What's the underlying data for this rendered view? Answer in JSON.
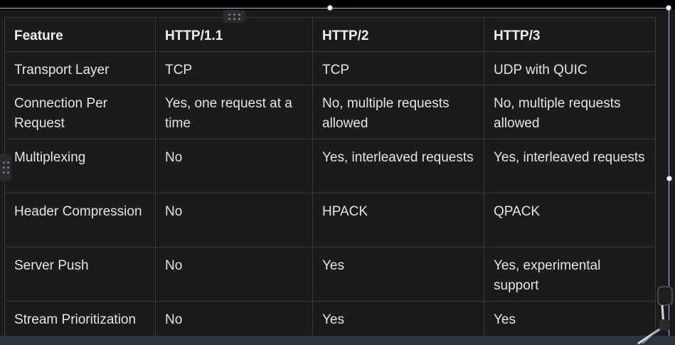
{
  "table": {
    "headers": [
      "Feature",
      "HTTP/1.1",
      "HTTP/2",
      "HTTP/3"
    ],
    "rows": [
      [
        "Transport Layer",
        "TCP",
        "TCP",
        "UDP with QUIC"
      ],
      [
        "Connection Per Request",
        "Yes, one request at a time",
        "No, multiple requests allowed",
        "No, multiple requests allowed"
      ],
      [
        "Multiplexing",
        "No",
        "Yes, interleaved requests",
        "Yes, interleaved requests"
      ],
      [
        "Header Compression",
        "No",
        "HPACK",
        "QPACK"
      ],
      [
        "Server Push",
        "No",
        "Yes",
        "Yes, experimental support"
      ],
      [
        "Stream Prioritization",
        "No",
        "Yes",
        "Yes"
      ]
    ]
  },
  "icons": {
    "column_drag": "drag-grip-icon",
    "row_drag": "drag-grip-icon",
    "resize_handles": "resize-handle-icon",
    "microphone": "microphone-arm-icon"
  },
  "colors": {
    "background": "#1b1b1d",
    "border": "#38383d",
    "text": "#e4e4e6",
    "selection": "#b8bddd"
  }
}
